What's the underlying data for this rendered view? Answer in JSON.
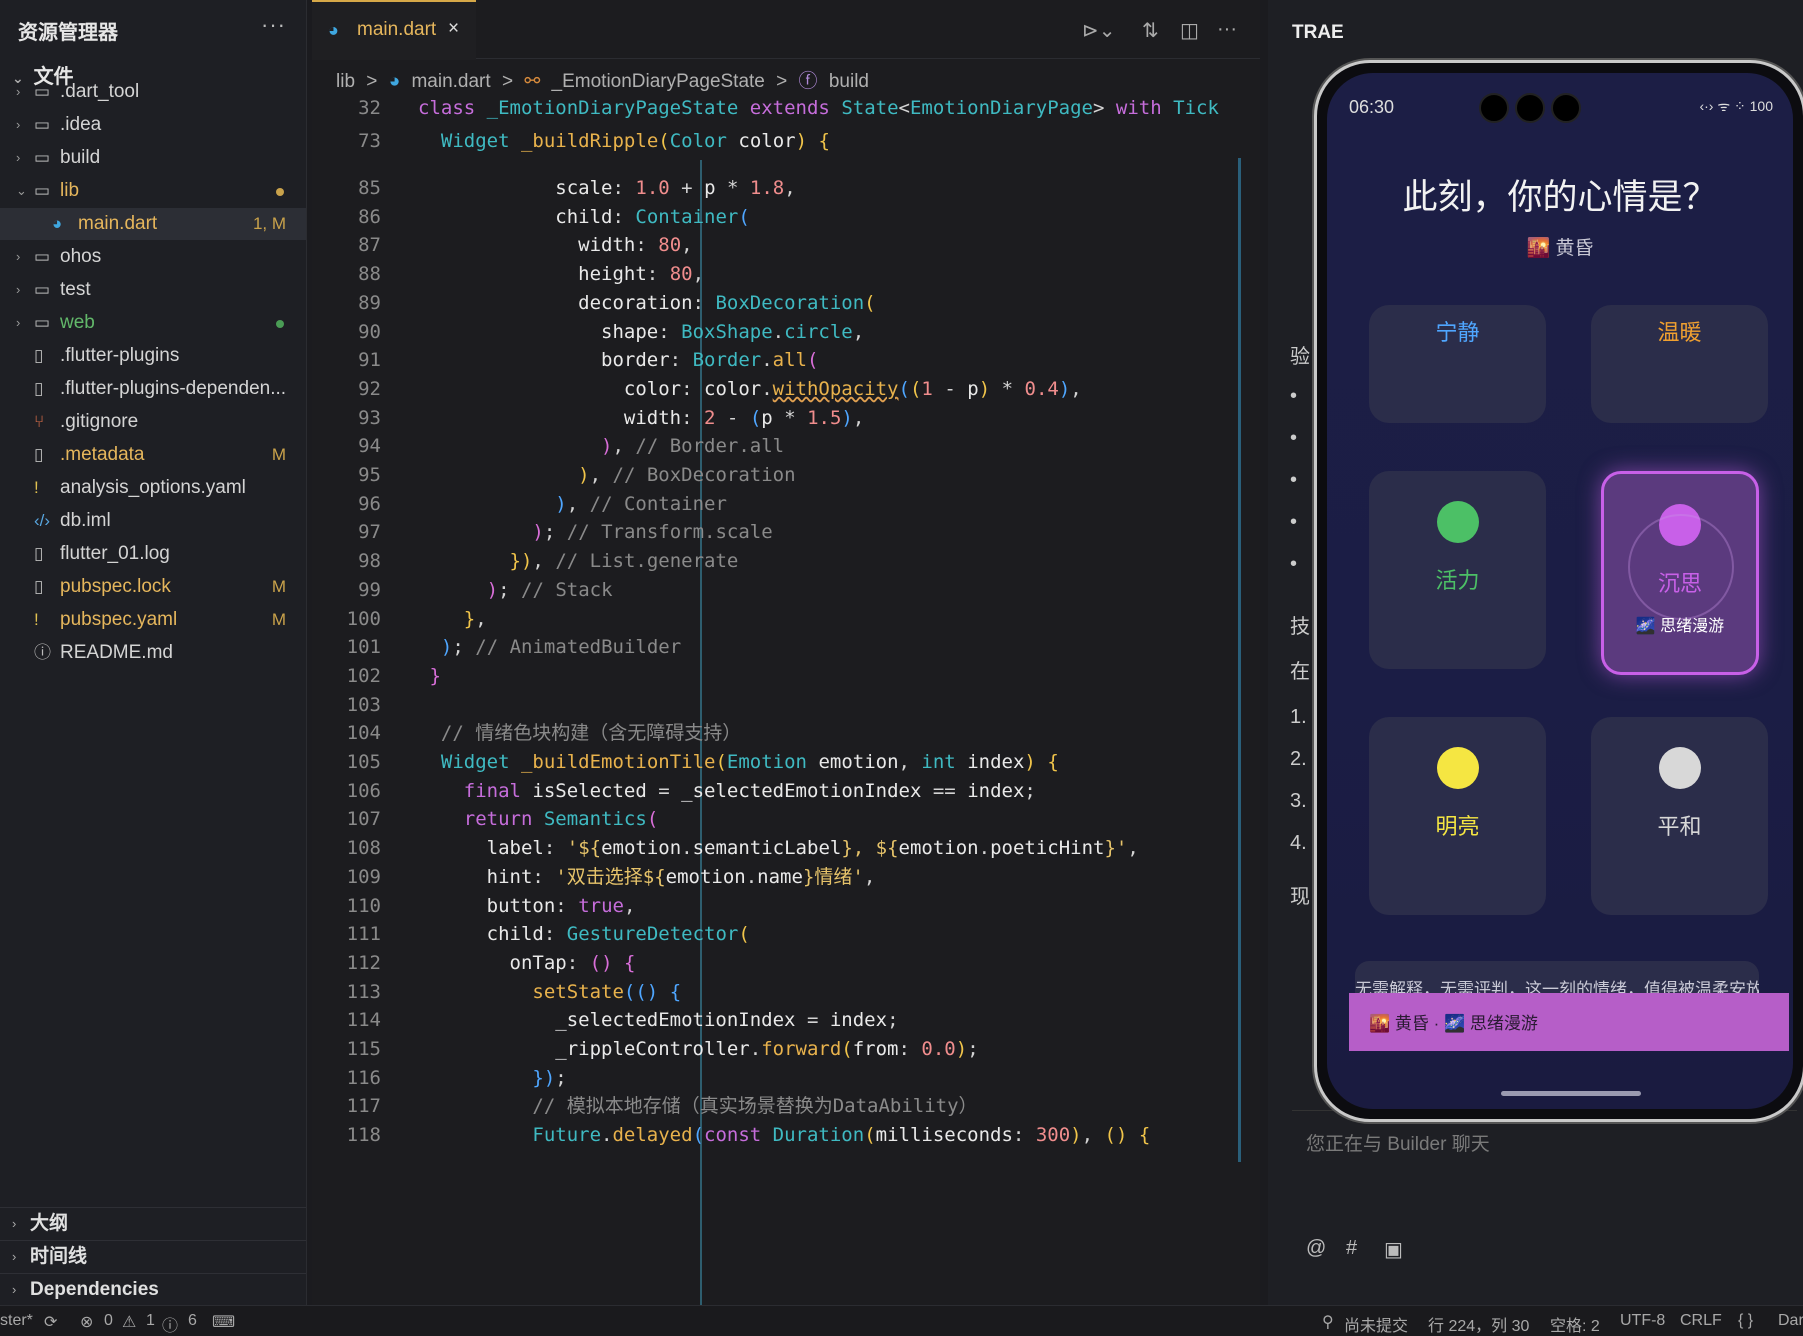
{
  "explorer": {
    "title": "资源管理器",
    "more": "···",
    "root": "文件",
    "items": [
      {
        "name": ".dart_tool",
        "kind": "folder",
        "badge": ""
      },
      {
        "name": ".idea",
        "kind": "folder",
        "badge": ""
      },
      {
        "name": "build",
        "kind": "folder",
        "badge": ""
      },
      {
        "name": "lib",
        "kind": "folder-open",
        "badge": ""
      },
      {
        "name": "main.dart",
        "kind": "dart",
        "badge": "1, M"
      },
      {
        "name": "ohos",
        "kind": "folder",
        "badge": ""
      },
      {
        "name": "test",
        "kind": "folder",
        "badge": ""
      },
      {
        "name": "web",
        "kind": "folder",
        "badge": ""
      },
      {
        "name": ".flutter-plugins",
        "kind": "file",
        "badge": ""
      },
      {
        "name": ".flutter-plugins-dependen...",
        "kind": "file",
        "badge": ""
      },
      {
        "name": ".gitignore",
        "kind": "git",
        "badge": ""
      },
      {
        "name": ".metadata",
        "kind": "file",
        "badge": "M"
      },
      {
        "name": "analysis_options.yaml",
        "kind": "yaml",
        "badge": ""
      },
      {
        "name": "db.iml",
        "kind": "xml",
        "badge": ""
      },
      {
        "name": "flutter_01.log",
        "kind": "file",
        "badge": ""
      },
      {
        "name": "pubspec.lock",
        "kind": "file",
        "badge": "M"
      },
      {
        "name": "pubspec.yaml",
        "kind": "yaml",
        "badge": "M"
      },
      {
        "name": "README.md",
        "kind": "info",
        "badge": ""
      }
    ],
    "bottom_sections": [
      "大纲",
      "时间线",
      "Dependencies"
    ]
  },
  "editor": {
    "tab_label": "main.dart",
    "tab_close": "×",
    "breadcrumb": [
      "lib",
      "main.dart",
      "_EmotionDiaryPageState",
      "build"
    ],
    "breadcrumb_sep": ">",
    "error_count": "1",
    "sticky": [
      {
        "ln": "32",
        "html": "<span class='k'>class</span> <span class='t'>_EmotionDiaryPageState</span> <span class='k'>extends</span> <span class='t'>State</span><span class='p'>&lt;</span><span class='t'>EmotionDiaryPage</span><span class='p'>&gt;</span> <span class='k'>with</span> <span class='t'>Tick</span>"
      },
      {
        "ln": "73",
        "html": "  <span class='t'>Widget</span> <span class='fn'>_buildRipple</span><span class='y'>(</span><span class='t'>Color</span> <span class='v'>color</span><span class='y'>)</span> <span class='y'>{</span>"
      }
    ],
    "lines": [
      {
        "ln": "85",
        "html": "            <span class='v'>scale</span><span class='p'>:</span> <span class='n'>1.0</span> <span class='p'>+</span> <span class='v'>p</span> <span class='p'>*</span> <span class='n'>1.8</span><span class='p'>,</span>"
      },
      {
        "ln": "86",
        "html": "            <span class='v'>child</span><span class='p'>:</span> <span class='t'>Container</span><span class='b'>(</span>"
      },
      {
        "ln": "87",
        "html": "              <span class='v'>width</span><span class='p'>:</span> <span class='n'>80</span><span class='p'>,</span>"
      },
      {
        "ln": "88",
        "html": "              <span class='v'>height</span><span class='p'>:</span> <span class='n'>80</span><span class='p'>,</span>"
      },
      {
        "ln": "89",
        "html": "              <span class='v'>decoration</span><span class='p'>:</span> <span class='t'>BoxDecoration</span><span class='y'>(</span>"
      },
      {
        "ln": "90",
        "html": "                <span class='v'>shape</span><span class='p'>:</span> <span class='t'>BoxShape</span><span class='p'>.</span><span class='t'>circle</span><span class='p'>,</span>"
      },
      {
        "ln": "91",
        "html": "                <span class='v'>border</span><span class='p'>:</span> <span class='t'>Border</span><span class='p'>.</span><span class='fn'>all</span><span class='m'>(</span>"
      },
      {
        "ln": "92",
        "html": "                  <span class='v'>color</span><span class='p'>:</span> <span class='v'>color</span><span class='p'>.</span><span class='wavy'>withOpacity</span><span class='b'>(</span><span class='y'>(</span><span class='n'>1</span> <span class='p'>-</span> <span class='v'>p</span><span class='y'>)</span> <span class='p'>*</span> <span class='n'>0.4</span><span class='b'>)</span><span class='p'>,</span>"
      },
      {
        "ln": "93",
        "html": "                  <span class='v'>width</span><span class='p'>:</span> <span class='n'>2</span> <span class='p'>-</span> <span class='b'>(</span><span class='v'>p</span> <span class='p'>*</span> <span class='n'>1.5</span><span class='b'>)</span><span class='p'>,</span>"
      },
      {
        "ln": "94",
        "html": "                <span class='m'>)</span><span class='p'>,</span> <span class='c'>// Border.all</span>"
      },
      {
        "ln": "95",
        "html": "              <span class='y'>)</span><span class='p'>,</span> <span class='c'>// BoxDecoration</span>"
      },
      {
        "ln": "96",
        "html": "            <span class='b'>)</span><span class='p'>,</span> <span class='c'>// Container</span>"
      },
      {
        "ln": "97",
        "html": "          <span class='m'>)</span><span class='p'>;</span> <span class='c'>// Transform.scale</span>"
      },
      {
        "ln": "98",
        "html": "        <span class='y'>})</span><span class='p'>,</span> <span class='c'>// List.generate</span>"
      },
      {
        "ln": "99",
        "html": "      <span class='m'>)</span><span class='p'>;</span> <span class='c'>// Stack</span>"
      },
      {
        "ln": "100",
        "html": "    <span class='y'>}</span><span class='p'>,</span>"
      },
      {
        "ln": "101",
        "html": "  <span class='b'>)</span><span class='p'>;</span> <span class='c'>// AnimatedBuilder</span>"
      },
      {
        "ln": "102",
        "html": " <span class='m'>}</span>"
      },
      {
        "ln": "103",
        "html": ""
      },
      {
        "ln": "104",
        "html": "  <span class='c'>// 情绪色块构建（含无障碍支持）</span>"
      },
      {
        "ln": "105",
        "html": "  <span class='t'>Widget</span> <span class='fn'>_buildEmotionTile</span><span class='y'>(</span><span class='t'>Emotion</span> <span class='v'>emotion</span><span class='p'>,</span> <span class='t'>int</span> <span class='v'>index</span><span class='y'>)</span> <span class='y'>{</span>"
      },
      {
        "ln": "106",
        "html": "    <span class='k'>final</span> <span class='v'>isSelected</span> <span class='p'>=</span> <span class='v'>_selectedEmotionIndex</span> <span class='p'>==</span> <span class='v'>index</span><span class='p'>;</span>"
      },
      {
        "ln": "107",
        "html": "    <span class='k'>return</span> <span class='t'>Semantics</span><span class='m'>(</span>"
      },
      {
        "ln": "108",
        "html": "      <span class='v'>label</span><span class='p'>:</span> <span class='s'>'${</span><span class='v'>emotion</span><span class='p'>.</span><span class='v'>semanticLabel</span><span class='s'>}, ${</span><span class='v'>emotion</span><span class='p'>.</span><span class='v'>poeticHint</span><span class='s'>}'</span><span class='p'>,</span>"
      },
      {
        "ln": "109",
        "html": "      <span class='v'>hint</span><span class='p'>:</span> <span class='s'>'双击选择${</span><span class='v'>emotion</span><span class='p'>.</span><span class='v'>name</span><span class='s'>}情绪'</span><span class='p'>,</span>"
      },
      {
        "ln": "110",
        "html": "      <span class='v'>button</span><span class='p'>:</span> <span class='k'>true</span><span class='p'>,</span>"
      },
      {
        "ln": "111",
        "html": "      <span class='v'>child</span><span class='p'>:</span> <span class='t'>GestureDetector</span><span class='y'>(</span>"
      },
      {
        "ln": "112",
        "html": "        <span class='v'>onTap</span><span class='p'>:</span> <span class='m'>()</span> <span class='m'>{</span>"
      },
      {
        "ln": "113",
        "html": "          <span class='fn'>setState</span><span class='b'>(()</span> <span class='b'>{</span>"
      },
      {
        "ln": "114",
        "html": "            <span class='v'>_selectedEmotionIndex</span> <span class='p'>=</span> <span class='v'>index</span><span class='p'>;</span>"
      },
      {
        "ln": "115",
        "html": "            <span class='v'>_rippleController</span><span class='p'>.</span><span class='fn'>forward</span><span class='y'>(</span><span class='v'>from</span><span class='p'>:</span> <span class='n'>0.0</span><span class='y'>)</span><span class='p'>;</span>"
      },
      {
        "ln": "116",
        "html": "          <span class='b'>})</span><span class='p'>;</span>"
      },
      {
        "ln": "117",
        "html": "          <span class='c'>// 模拟本地存储（真实场景替换为DataAbility）</span>"
      },
      {
        "ln": "118",
        "html": "          <span class='t'>Future</span><span class='p'>.</span><span class='fn'>delayed</span><span class='b'>(</span><span class='k'>const</span> <span class='t'>Duration</span><span class='y'>(</span><span class='v'>milliseconds</span><span class='p'>:</span> <span class='n'>300</span><span class='y'>)</span><span class='p'>,</span> <span class='y'>()</span> <span class='y'>{</span>"
      }
    ]
  },
  "right_panel": {
    "title": "TRAE",
    "side_chars": [
      "验",
      "•",
      "•",
      "•",
      "•",
      "•",
      "技",
      "在",
      "1.",
      "2.",
      "3.",
      "4.",
      "现"
    ],
    "chat_placeholder": "您正在与 Builder 聊天",
    "chat_icons": [
      "@",
      "#",
      "▣"
    ]
  },
  "phone": {
    "time": "06:30",
    "status_icons": "‹·› ᯤ ⁘ 100",
    "title": "此刻，你的心情是？",
    "subtitle": "🌇 黄昏",
    "tiles": [
      {
        "name": "宁静",
        "color": "#4fa6ff",
        "ball": "",
        "poetic": "",
        "selected": false
      },
      {
        "name": "温暖",
        "color": "#f0a030",
        "ball": "",
        "poetic": "",
        "selected": false
      },
      {
        "name": "活力",
        "color": "#4cc066",
        "ball": "#4cc066",
        "poetic": "",
        "selected": false
      },
      {
        "name": "沉思",
        "color": "#c860e8",
        "ball": "#c860e8",
        "poetic": "🌌 思绪漫游",
        "selected": true
      },
      {
        "name": "明亮",
        "color": "#f5e642",
        "ball": "#f5e642",
        "poetic": "",
        "selected": false
      },
      {
        "name": "平和",
        "color": "#d8d8d8",
        "ball": "#d8d8d8",
        "poetic": "",
        "selected": false
      }
    ],
    "message": "无需解释，无需评判，这一刻的情绪，值得被温柔安放",
    "banner": "🌇 黄昏 · 🌌 思绪漫游"
  },
  "statusbar": {
    "branch": "ster*",
    "errors": "0",
    "warnings": "1",
    "infos": "6",
    "commit": "尚未提交",
    "position": "行 224，列 30",
    "spaces": "空格: 2",
    "encoding": "UTF-8",
    "eol": "CRLF",
    "braces": "{ }",
    "lang": "Dar"
  }
}
